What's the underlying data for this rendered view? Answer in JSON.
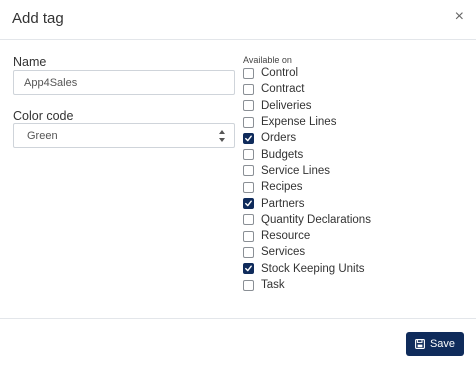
{
  "modal": {
    "title": "Add tag",
    "close_glyph": "×"
  },
  "form": {
    "name_label": "Name",
    "name_value": "App4Sales",
    "color_label": "Color code",
    "color_value": "Green",
    "available_label": "Available on"
  },
  "available_on": [
    {
      "label": "Control",
      "checked": false
    },
    {
      "label": "Contract",
      "checked": false
    },
    {
      "label": "Deliveries",
      "checked": false
    },
    {
      "label": "Expense Lines",
      "checked": false
    },
    {
      "label": "Orders",
      "checked": true
    },
    {
      "label": "Budgets",
      "checked": false
    },
    {
      "label": "Service Lines",
      "checked": false
    },
    {
      "label": "Recipes",
      "checked": false
    },
    {
      "label": "Partners",
      "checked": true
    },
    {
      "label": "Quantity Declarations",
      "checked": false
    },
    {
      "label": "Resource",
      "checked": false
    },
    {
      "label": "Services",
      "checked": false
    },
    {
      "label": "Stock Keeping Units",
      "checked": true
    },
    {
      "label": "Task",
      "checked": false
    }
  ],
  "footer": {
    "save_label": "Save",
    "save_icon": "floppy-disk-icon"
  },
  "colors": {
    "primary": "#0f2b5b",
    "border": "#cfd4da"
  }
}
